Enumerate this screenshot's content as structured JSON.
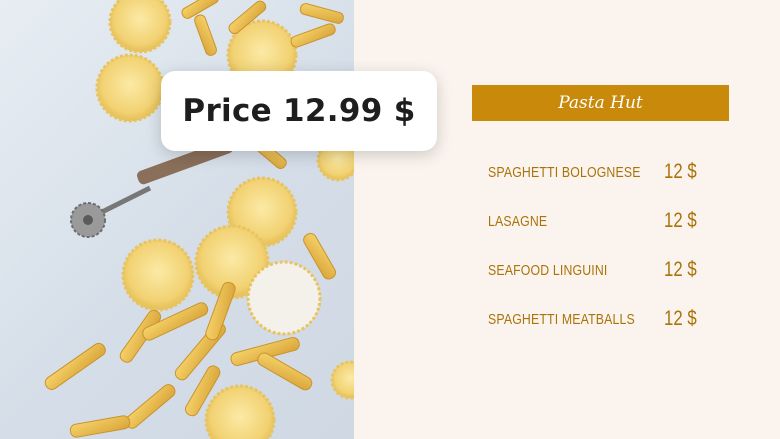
{
  "price_card": {
    "text": "Price 12.99 $"
  },
  "banner": {
    "title": "Pasta Hut",
    "color": "#c98a0b"
  },
  "menu": {
    "items": [
      {
        "name": "SPAGHETTI BOLOGNESE",
        "price": "12 $"
      },
      {
        "name": "LASAGNE",
        "price": "12 $"
      },
      {
        "name": "SEAFOOD LINGUINI",
        "price": "12 $"
      },
      {
        "name": "SPAGHETTI MEATBALLS",
        "price": "12 $"
      }
    ]
  },
  "colors": {
    "accent": "#c98a0b",
    "text_gold": "#a9730a",
    "background": "#fbf4ee"
  }
}
